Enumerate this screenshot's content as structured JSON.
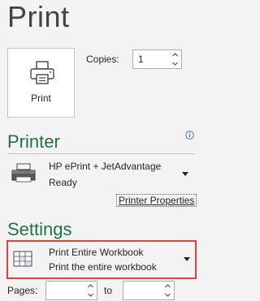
{
  "title": "Print",
  "print_button": {
    "label": "Print",
    "icon": "printer-icon"
  },
  "copies": {
    "label": "Copies:",
    "value": "1"
  },
  "printer": {
    "section_title": "Printer",
    "name": "HP ePrint + JetAdvantage",
    "status": "Ready",
    "properties_link": "Printer Properties",
    "info_icon": "info-icon"
  },
  "settings": {
    "section_title": "Settings",
    "scope": {
      "main": "Print Entire Workbook",
      "sub": "Print the entire workbook",
      "icon": "workbook-sheet-icon"
    },
    "highlight_color": "#e0403f"
  },
  "pages": {
    "label": "Pages:",
    "from_value": "",
    "to_label": "to",
    "to_value": ""
  },
  "colors": {
    "accent": "#217346",
    "background": "#f3f3f3"
  }
}
